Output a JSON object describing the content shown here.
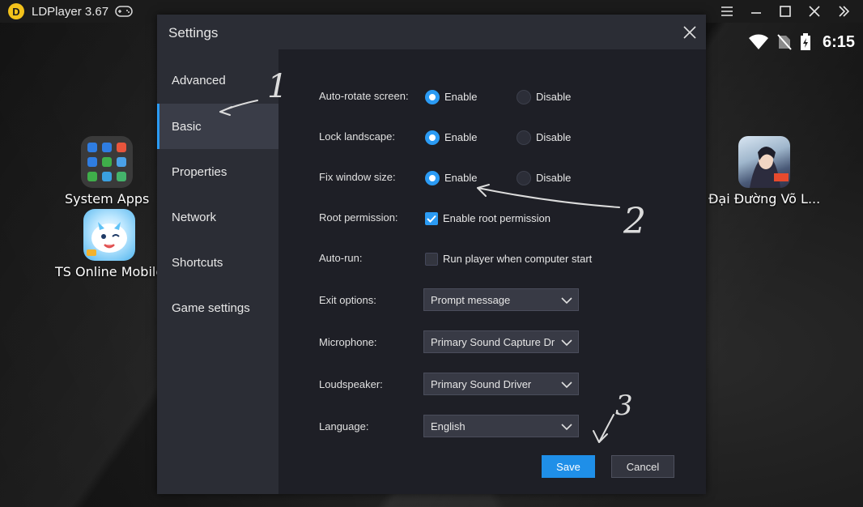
{
  "window": {
    "title": "LDPlayer 3.67",
    "controls": [
      "menu",
      "minimize",
      "maximize",
      "close",
      "collapse"
    ]
  },
  "status": {
    "time": "6:15"
  },
  "desktop": {
    "apps": [
      {
        "name": "System Apps"
      },
      {
        "name": "TS Online Mobile"
      },
      {
        "name": "Đại Đường Võ L..."
      }
    ]
  },
  "settings": {
    "title": "Settings",
    "nav": [
      {
        "label": "Advanced"
      },
      {
        "label": "Basic",
        "active": true
      },
      {
        "label": "Properties"
      },
      {
        "label": "Network"
      },
      {
        "label": "Shortcuts"
      },
      {
        "label": "Game settings"
      }
    ],
    "rows": {
      "autorotate": {
        "label": "Auto-rotate screen:",
        "enable": "Enable",
        "disable": "Disable",
        "selected": "Enable"
      },
      "lock_landscape": {
        "label": "Lock landscape:",
        "enable": "Enable",
        "disable": "Disable",
        "selected": "Enable"
      },
      "fix_window": {
        "label": "Fix window size:",
        "enable": "Enable",
        "disable": "Disable",
        "selected": "Enable"
      },
      "root": {
        "label": "Root permission:",
        "option": "Enable root permission",
        "checked": true
      },
      "autorun": {
        "label": "Auto-run:",
        "option": "Run player when computer start",
        "checked": false
      },
      "exit": {
        "label": "Exit options:",
        "value": "Prompt message"
      },
      "microphone": {
        "label": "Microphone:",
        "value": "Primary Sound Capture Dr"
      },
      "loudspeaker": {
        "label": "Loudspeaker:",
        "value": "Primary Sound Driver"
      },
      "language": {
        "label": "Language:",
        "value": "English"
      }
    },
    "buttons": {
      "save": "Save",
      "cancel": "Cancel"
    }
  },
  "annotations": {
    "mark1": "1",
    "mark2": "2",
    "mark3": "3"
  },
  "colors": {
    "accent": "#2b9bf4",
    "dialog_bg": "#2b2d35",
    "content_bg": "#1e1f26",
    "logo": "#f3c21b"
  }
}
